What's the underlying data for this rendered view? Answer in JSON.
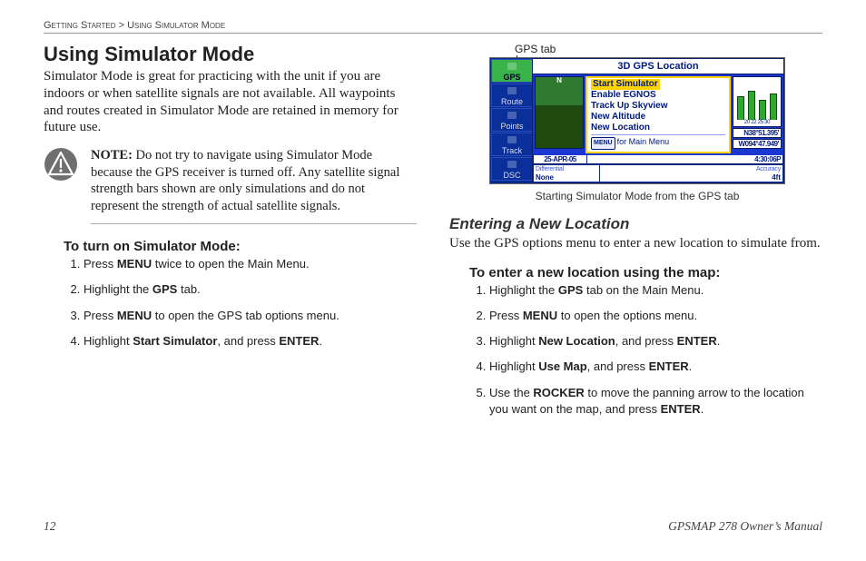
{
  "breadcrumb": {
    "chapter": "Getting Started",
    "sep": ">",
    "section": "Using Simulator Mode"
  },
  "title": "Using Simulator Mode",
  "intro": "Simulator Mode is great for practicing with the unit if you are indoors or when satellite signals are not available. All waypoints and routes created in Simulator Mode are retained in memory for future use.",
  "note": {
    "label": "NOTE:",
    "text": " Do not try to navigate using Simulator Mode because the GPS receiver is turned off. Any satellite signal strength bars shown are only simulations and do not represent the strength of actual satellite signals."
  },
  "turn_on": {
    "heading": "To turn on Simulator Mode:",
    "steps": [
      "Press <b>MENU</b> twice to open the Main Menu.",
      "Highlight the <b>GPS</b> tab.",
      "Press <b>MENU</b> to open the GPS tab options menu.",
      "Highlight <b>Start Simulator</b>, and press <b>ENTER</b>."
    ]
  },
  "figure": {
    "top_label": "GPS tab",
    "sidebar_tabs": [
      "GPS",
      "Route",
      "Points",
      "Track",
      "DSC"
    ],
    "screen_title": "3D GPS Location",
    "menu_items": [
      "Start Simulator",
      "Enable EGNOS",
      "Track Up Skyview",
      "New Altitude",
      "New Location"
    ],
    "menu_footer_key": "MENU",
    "menu_footer_text": "for Main Menu",
    "sat_labels": "20 22 25 30",
    "coord1": "N38°51.395'",
    "coord2": "W094°47.949'",
    "date": "25-APR-05",
    "time": "4:30:06P",
    "status_left_label": "Differential",
    "status_left_value": "None",
    "status_right_label": "Accuracy",
    "status_right_value": "4ft",
    "caption": "Starting Simulator Mode from the GPS tab"
  },
  "enter_loc": {
    "heading": "Entering a New Location",
    "intro": "Use the GPS options menu to enter a new location to simulate from.",
    "sub_heading": "To enter a new location using the map:",
    "steps": [
      "Highlight the <b>GPS</b> tab on the Main Menu.",
      "Press <b>MENU</b> to open the options menu.",
      "Highlight <b>New Location</b>, and press <b>ENTER</b>.",
      "Highlight <b>Use Map</b>, and press <b>ENTER</b>.",
      "Use the <b>ROCKER</b> to move the panning arrow to the location you want on the map, and press <b>ENTER</b>."
    ]
  },
  "footer": {
    "page": "12",
    "manual": "GPSMAP 278 Owner’s Manual"
  }
}
